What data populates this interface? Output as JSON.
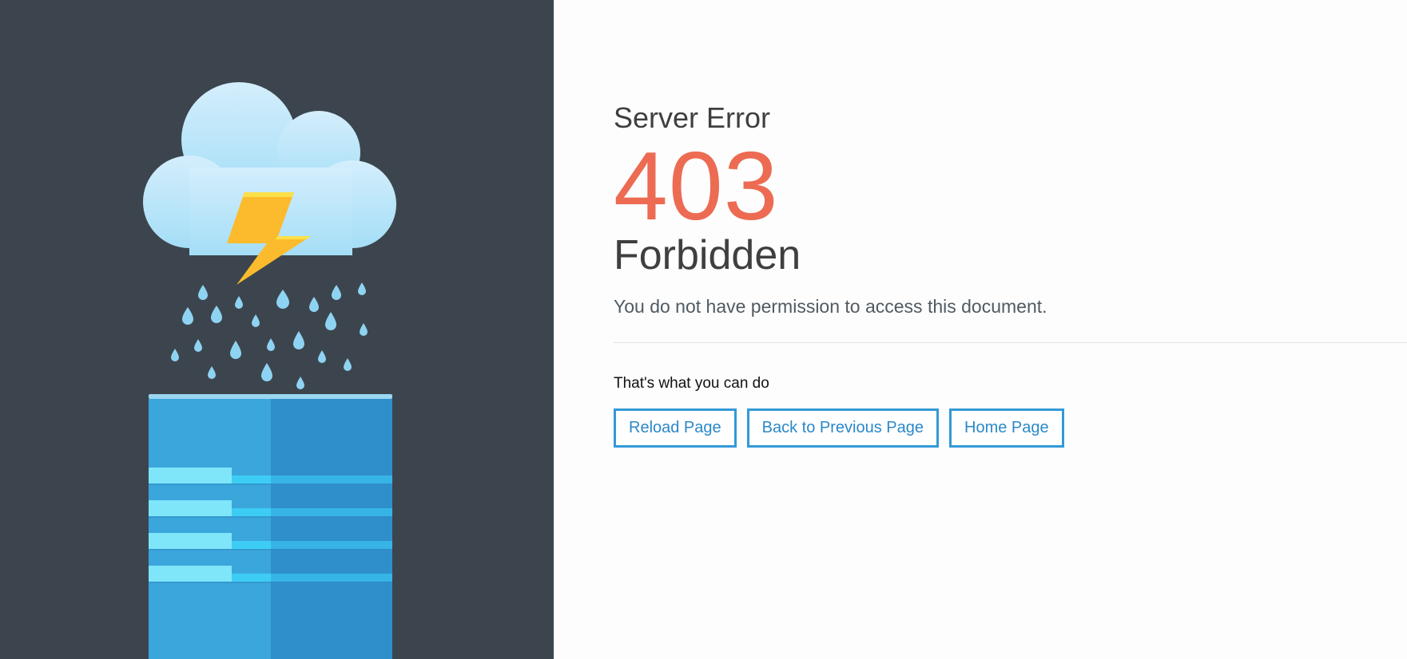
{
  "error": {
    "title": "Server Error",
    "code": "403",
    "status": "Forbidden",
    "message": "You do not have permission to access this document."
  },
  "actions": {
    "heading": "That's what you can do",
    "buttons": [
      {
        "label": "Reload Page"
      },
      {
        "label": "Back to Previous Page"
      },
      {
        "label": "Home Page"
      }
    ]
  },
  "colors": {
    "left_panel_bg": "#3c454e",
    "error_code": "#ec6b52",
    "button_accent": "#3399d7"
  },
  "illustration": {
    "icons": [
      "cloud-icon",
      "lightning-bolt-icon",
      "raindrops-icon",
      "server-tower-icon"
    ]
  }
}
